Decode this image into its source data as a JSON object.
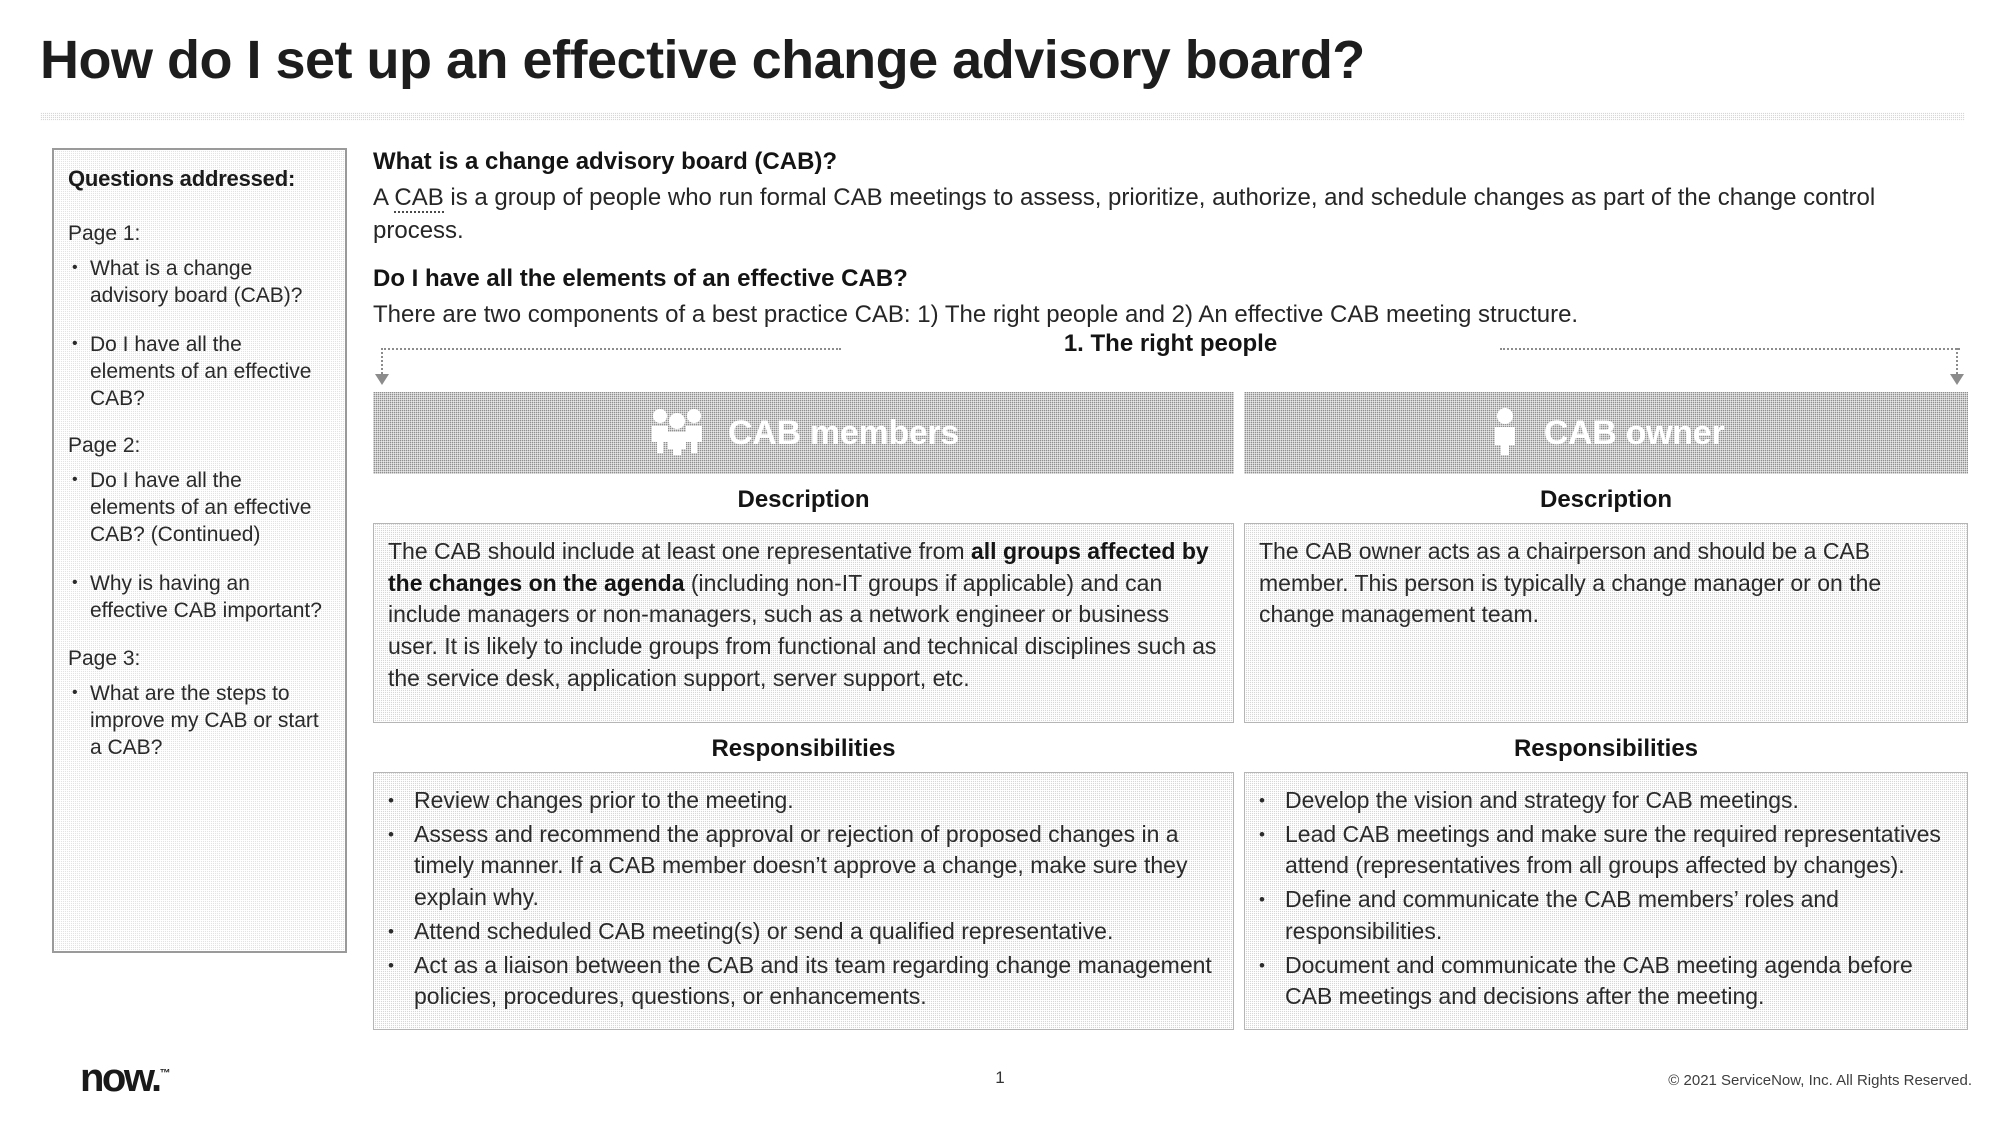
{
  "header": {
    "title": "How do I set up an effective change advisory board?"
  },
  "sidebar": {
    "title": "Questions addressed:",
    "bullet_glyph": "•",
    "groups": [
      {
        "label": "Page 1:",
        "items": [
          "What is a change advisory board (CAB)?",
          "Do I have all the elements of an effective CAB?"
        ]
      },
      {
        "label": "Page 2:",
        "items": [
          "Do I have all the elements of an effective CAB? (Continued)",
          "Why is having an effective CAB important?"
        ]
      },
      {
        "label": "Page 3:",
        "items": [
          "What are the steps to improve my CAB or start a CAB?"
        ]
      }
    ]
  },
  "intro": {
    "q1_heading": "What is a change advisory board (CAB)?",
    "q1_answer_pre": "A ",
    "q1_answer_link": "CAB",
    "q1_answer_post": " is a group of people who run formal CAB meetings to assess, prioritize, authorize, and schedule changes as part of the change control process.",
    "q2_heading": "Do I have all the elements of an effective CAB?",
    "q2_answer": "There are two components of a best practice CAB: 1) The right people and 2) An effective CAB meeting structure."
  },
  "connector": {
    "label": "1. The right people"
  },
  "columns": [
    {
      "key": "cab-members",
      "title": "CAB members",
      "icon": "people-group-icon",
      "description_label": "Description",
      "description_parts": [
        {
          "text": "The CAB should include at least one representative from ",
          "bold": false
        },
        {
          "text": "all groups affected by the changes on the agenda",
          "bold": true
        },
        {
          "text": " (including non-IT groups if applicable) and can include managers or non-managers, such as a network engineer or business user. It is likely to include groups from functional and technical disciplines such as the service desk, application support, server support, etc.",
          "bold": false
        }
      ],
      "responsibilities_label": "Responsibilities",
      "responsibilities": [
        "Review changes prior to the meeting.",
        "Assess and recommend the approval or rejection of proposed changes in a timely manner. If a CAB member doesn’t approve a change, make sure they explain why.",
        "Attend scheduled CAB meeting(s) or send a qualified representative.",
        "Act as a liaison between the CAB and its team regarding change management policies, procedures, questions, or enhancements."
      ]
    },
    {
      "key": "cab-owner",
      "title": "CAB owner",
      "icon": "person-icon",
      "description_label": "Description",
      "description_parts": [
        {
          "text": "The CAB owner acts as a chairperson and should be a CAB member. This person is typically a change manager or on the change management team.",
          "bold": false
        }
      ],
      "responsibilities_label": "Responsibilities",
      "responsibilities": [
        "Develop the vision and strategy for CAB meetings.",
        "Lead CAB meetings and make sure the required representatives attend (representatives from all groups affected by changes).",
        "Define and communicate the CAB members’ roles and responsibilities.",
        "Document and communicate the CAB meeting agenda before CAB meetings and decisions after the meeting."
      ]
    }
  ],
  "footer": {
    "logo_text": "now",
    "logo_dot": ".",
    "logo_tm": "™",
    "page_number": "1",
    "copyright": "© 2021 ServiceNow, Inc. All Rights Reserved."
  },
  "colors": {
    "header_bar": "#8f8f8f",
    "panel_fill": "#d7d7d7",
    "rule": "#b9b9b9",
    "text": "#262626"
  }
}
